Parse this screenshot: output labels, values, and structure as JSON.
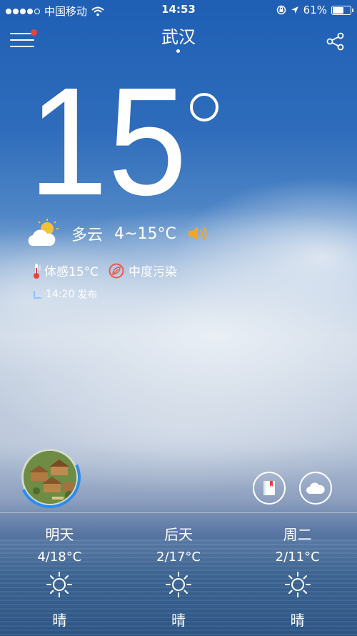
{
  "status_bar": {
    "carrier": "中国移动",
    "time": "14:53",
    "battery": "61%",
    "battery_level": 0.61
  },
  "header": {
    "city": "武汉",
    "menu_icon": "menu-icon",
    "share_icon": "share-icon",
    "notification_color": "#e8413c"
  },
  "current": {
    "temperature": "15",
    "condition": "多云",
    "range": "4~15°C",
    "feels_like": "体感15°C",
    "pollution": "中度污染",
    "publish_time": "14:20",
    "publish_label": "发布"
  },
  "forecast": [
    {
      "day": "明天",
      "range": "4/18°C",
      "condition": "晴",
      "icon": "sun-icon"
    },
    {
      "day": "后天",
      "range": "2/17°C",
      "condition": "晴",
      "icon": "sun-icon"
    },
    {
      "day": "周二",
      "range": "2/11°C",
      "condition": "晴",
      "icon": "sun-icon"
    }
  ],
  "colors": {
    "accent_ring": "#2a8cf0",
    "thermometer": "#e8413c",
    "pollution": "#e85a4f"
  }
}
